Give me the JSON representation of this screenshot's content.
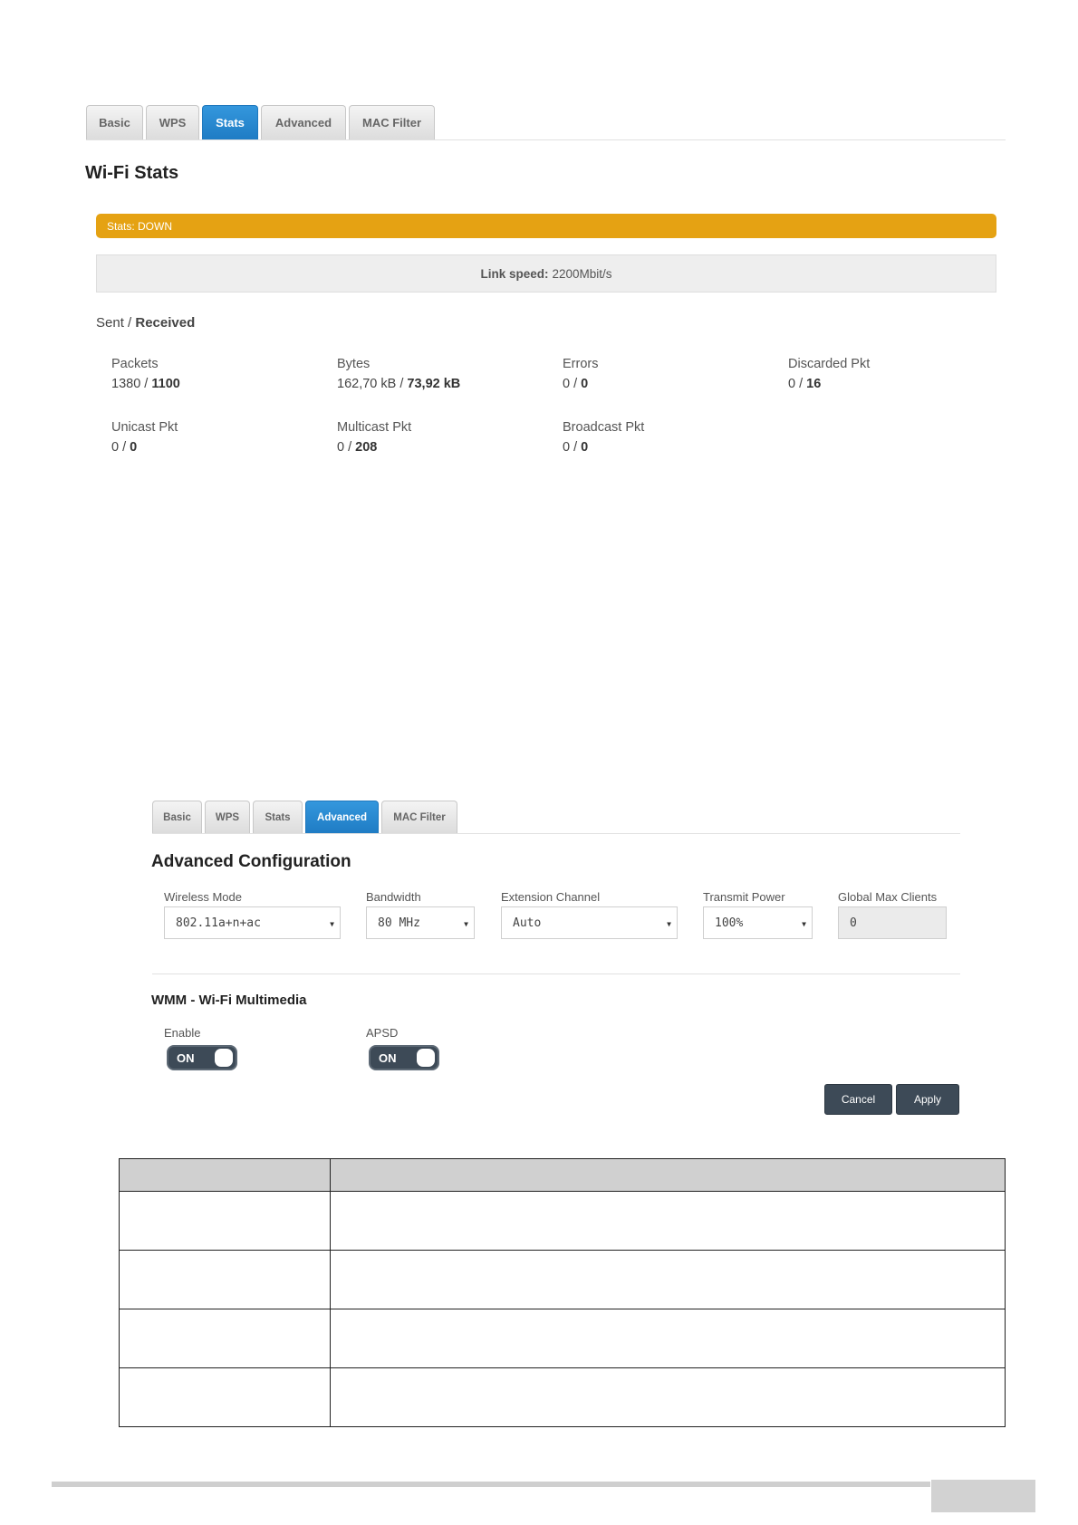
{
  "stats_page": {
    "tabs": [
      {
        "label": "Basic",
        "active": false
      },
      {
        "label": "WPS",
        "active": false
      },
      {
        "label": "Stats",
        "active": true
      },
      {
        "label": "Advanced",
        "active": false
      },
      {
        "label": "MAC Filter",
        "active": false
      }
    ],
    "title": "Wi-Fi Stats",
    "status": "Stats: DOWN",
    "status_color": "#e5a213",
    "link_speed_label": "Link speed:",
    "link_speed_value": "2200Mbit/s",
    "sent_received": {
      "sent": "Sent",
      "sep": "/",
      "received": "Received"
    },
    "stats": [
      {
        "label": "Packets",
        "sent": "1380",
        "received": "1100"
      },
      {
        "label": "Bytes",
        "sent": "162,70 kB",
        "received": "73,92 kB"
      },
      {
        "label": "Errors",
        "sent": "0",
        "received": "0"
      },
      {
        "label": "Discarded Pkt",
        "sent": "0",
        "received": "16"
      },
      {
        "label": "Unicast Pkt",
        "sent": "0",
        "received": "0"
      },
      {
        "label": "Multicast Pkt",
        "sent": "0",
        "received": "208"
      },
      {
        "label": "Broadcast Pkt",
        "sent": "0",
        "received": "0"
      }
    ]
  },
  "advanced_page": {
    "tabs": [
      {
        "label": "Basic",
        "active": false
      },
      {
        "label": "WPS",
        "active": false
      },
      {
        "label": "Stats",
        "active": false
      },
      {
        "label": "Advanced",
        "active": true
      },
      {
        "label": "MAC Filter",
        "active": false
      }
    ],
    "title": "Advanced Configuration",
    "fields": {
      "wireless_mode": {
        "label": "Wireless Mode",
        "value": "802.11a+n+ac"
      },
      "bandwidth": {
        "label": "Bandwidth",
        "value": "80 MHz"
      },
      "extension_channel": {
        "label": "Extension Channel",
        "value": "Auto"
      },
      "transmit_power": {
        "label": "Transmit Power",
        "value": "100%"
      },
      "global_max_clients": {
        "label": "Global Max Clients",
        "value": "0"
      }
    },
    "wmm_title": "WMM - Wi-Fi Multimedia",
    "enable": {
      "label": "Enable",
      "state": "ON"
    },
    "apsd": {
      "label": "APSD",
      "state": "ON"
    },
    "cancel_label": "Cancel",
    "apply_label": "Apply"
  }
}
